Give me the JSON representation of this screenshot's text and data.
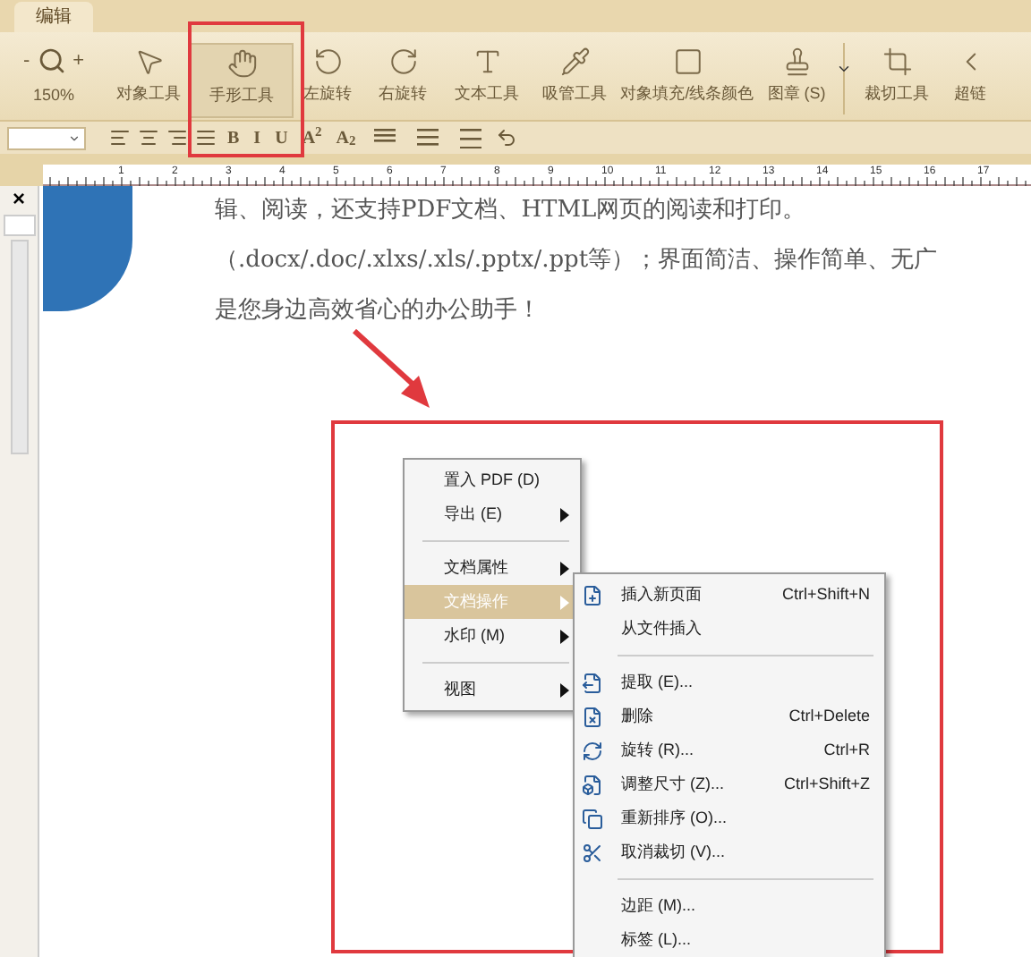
{
  "tabs": [
    {
      "label": "编辑",
      "selected": true
    }
  ],
  "toolbar": {
    "zoom_out": "-",
    "zoom_in": "+",
    "zoom_value": "150%",
    "tools": [
      {
        "label": "对象工具",
        "kind": "pointer",
        "selected": false
      },
      {
        "label": "手形工具",
        "kind": "hand",
        "selected": true
      },
      {
        "label": "左旋转",
        "kind": "rotate-left",
        "selected": false
      },
      {
        "label": "右旋转",
        "kind": "rotate-right",
        "selected": false
      },
      {
        "label": "文本工具",
        "kind": "text",
        "selected": false
      },
      {
        "label": "吸管工具",
        "kind": "pipette",
        "selected": false
      },
      {
        "label": "对象填充/线条颜色",
        "kind": "fill",
        "selected": false
      },
      {
        "label": "图章 (S)",
        "kind": "stamp",
        "selected": false,
        "dropdown": true
      },
      {
        "label": "裁切工具",
        "kind": "crop",
        "selected": false
      },
      {
        "label": "超链",
        "kind": "link",
        "selected": false
      }
    ]
  },
  "format_bar": {
    "buttons": [
      {
        "kind": "align-left"
      },
      {
        "kind": "align-center"
      },
      {
        "kind": "align-right"
      },
      {
        "kind": "align-justify"
      },
      {
        "kind": "text",
        "label": "B"
      },
      {
        "kind": "text",
        "label": "I"
      },
      {
        "kind": "text",
        "label": "U"
      },
      {
        "kind": "text",
        "label": "A$^{2}$"
      },
      {
        "kind": "text",
        "label": "A$_{2}$"
      },
      {
        "kind": "spacing-1"
      },
      {
        "kind": "spacing-2"
      },
      {
        "kind": "spacing-3"
      },
      {
        "kind": "undo"
      }
    ]
  },
  "ruler": {
    "labels": [
      "1",
      "2",
      "3",
      "4",
      "5",
      "6",
      "7",
      "8",
      "9",
      "10",
      "11",
      "12",
      "13",
      "14",
      "15",
      "16",
      "17"
    ]
  },
  "left_panel": {
    "close": "×"
  },
  "document": {
    "lines": [
      "辑、阅读，还支持PDF文档、HTML网页的阅读和打印。",
      "（.docx/.doc/.xlxs/.xls/.pptx/.ppt等）；界面简洁、操作简单、无广",
      "是您身边高效省心的办公助手！"
    ]
  },
  "context_menu": {
    "items": [
      {
        "kind": "item",
        "label": "置入 PDF (D)",
        "submenu": false,
        "selected": false
      },
      {
        "kind": "item",
        "label": "导出 (E)",
        "submenu": true,
        "selected": false
      },
      {
        "kind": "separator"
      },
      {
        "kind": "item",
        "label": "文档属性",
        "submenu": true,
        "selected": false
      },
      {
        "kind": "item",
        "label": "文档操作",
        "submenu": true,
        "selected": true
      },
      {
        "kind": "item",
        "label": "水印 (M)",
        "submenu": true,
        "selected": false
      },
      {
        "kind": "separator"
      },
      {
        "kind": "item",
        "label": "视图",
        "submenu": true,
        "selected": false
      }
    ]
  },
  "submenu": {
    "items": [
      {
        "kind": "insert",
        "label": "插入新页面",
        "shortcut": "Ctrl+Shift+N"
      },
      {
        "kind": "plain",
        "label": "从文件插入"
      },
      {
        "kind": "separator"
      },
      {
        "kind": "extract",
        "label": "提取 (E)..."
      },
      {
        "kind": "delete",
        "label": "删除",
        "shortcut": "Ctrl+Delete"
      },
      {
        "kind": "rotate",
        "label": "旋转 (R)...",
        "shortcut": "Ctrl+R"
      },
      {
        "kind": "resize",
        "label": "调整尺寸 (Z)...",
        "shortcut": "Ctrl+Shift+Z"
      },
      {
        "kind": "reorder",
        "label": "重新排序 (O)..."
      },
      {
        "kind": "uncrop",
        "label": "取消裁切 (V)..."
      },
      {
        "kind": "separator"
      },
      {
        "kind": "plain",
        "label": "边距 (M)..."
      },
      {
        "kind": "plain",
        "label": "标签 (L)..."
      }
    ]
  }
}
